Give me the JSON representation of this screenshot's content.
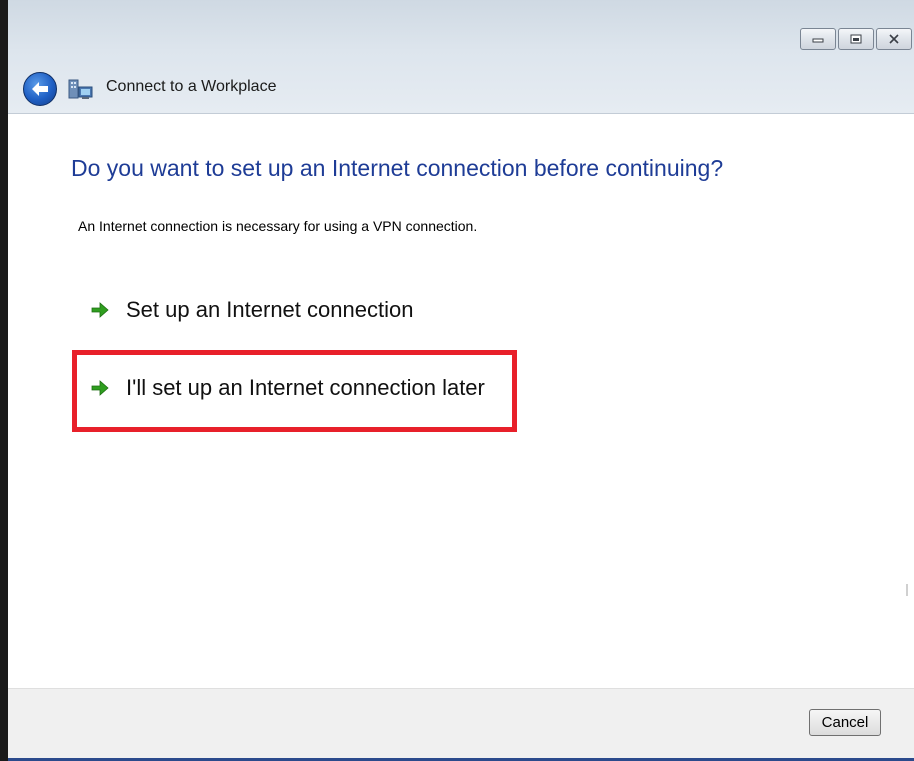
{
  "window": {
    "title": "Connect to a Workplace",
    "icons": {
      "back": "back-arrow-icon",
      "app": "network-workplace-icon",
      "minimize": "minimize-icon",
      "maximize": "maximize-icon",
      "close": "close-icon"
    }
  },
  "main": {
    "heading": "Do you want to set up an Internet connection before continuing?",
    "description": "An Internet connection is necessary for using a VPN connection.",
    "options": [
      {
        "label": "Set up an Internet connection",
        "icon": "green-arrow-icon"
      },
      {
        "label": "I'll set up an Internet connection later",
        "icon": "green-arrow-icon",
        "highlighted": true
      }
    ]
  },
  "footer": {
    "cancel_label": "Cancel"
  },
  "colors": {
    "heading": "#1e3c96",
    "highlight": "#e8202a",
    "arrow": "#2f9e1f"
  }
}
